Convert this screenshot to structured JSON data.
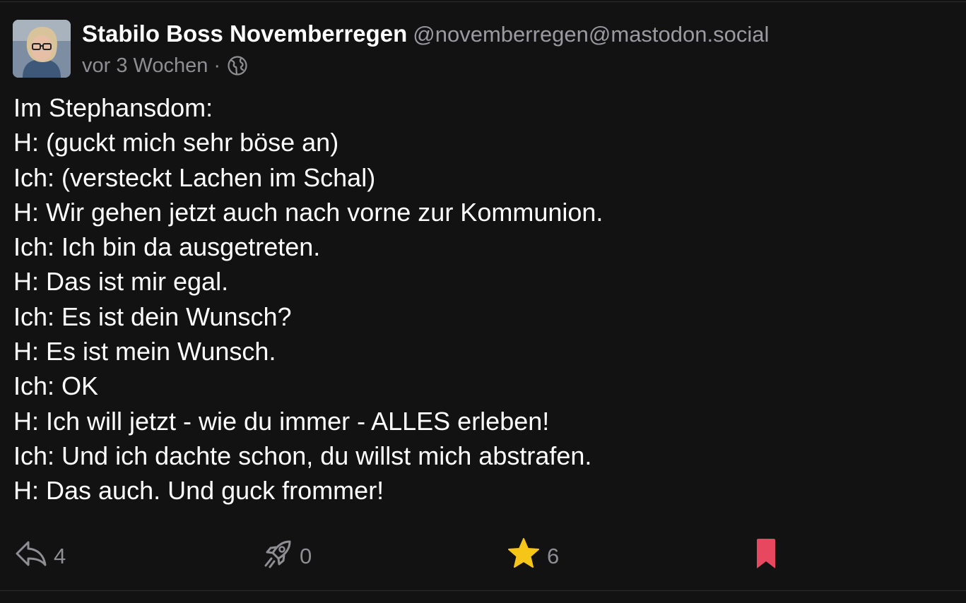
{
  "post": {
    "author": {
      "display_name": "Stabilo Boss Novemberregen",
      "handle": "@novemberregen@mastodon.social",
      "avatar": "avatar-photo"
    },
    "meta": {
      "time": "vor 3 Wochen",
      "separator": "·",
      "visibility_icon": "globe-icon"
    },
    "lines": [
      "Im Stephansdom:",
      "H: (guckt mich sehr böse an)",
      "Ich: (versteckt Lachen im Schal)",
      "H: Wir gehen jetzt auch nach vorne zur Kommunion.",
      "Ich: Ich bin da ausgetreten.",
      "H: Das ist mir egal.",
      "Ich: Es ist dein Wunsch?",
      "H: Es ist mein Wunsch.",
      "Ich: OK",
      "H: Ich will jetzt - wie du immer - ALLES erleben!",
      "Ich: Und ich dachte schon, du willst mich abstrafen.",
      "H: Das auch. Und guck frommer!"
    ],
    "actions": {
      "reply": {
        "icon": "reply-icon",
        "count": "4"
      },
      "boost": {
        "icon": "rocket-icon",
        "count": "0"
      },
      "favourite": {
        "icon": "star-icon",
        "count": "6"
      },
      "bookmark": {
        "icon": "bookmark-icon"
      }
    }
  },
  "colors": {
    "background": "#121213",
    "text": "#ffffff",
    "muted": "#8e8e93",
    "star": "#f5c518",
    "bookmark": "#e8485f"
  }
}
